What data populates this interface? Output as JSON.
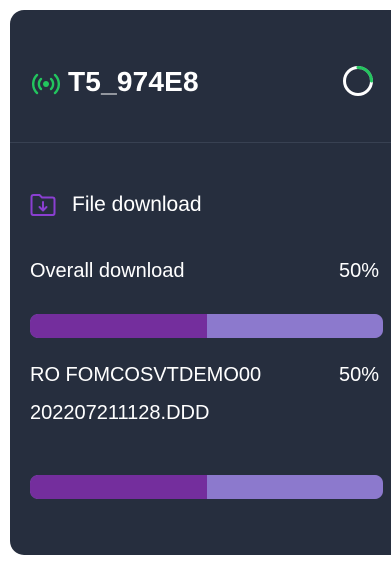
{
  "device": {
    "name": "T5_974E8",
    "signal_icon": "wifi-broadcast-icon",
    "status_icon": "loading-spinner-icon",
    "signal_color": "#22c55e"
  },
  "file_download": {
    "section_title": "File download",
    "section_icon": "folder-download-icon",
    "accent_color": "#8a3fd1",
    "overall": {
      "label": "Overall download",
      "percent_text": "50%",
      "progress": 0.5
    },
    "files": [
      {
        "name_line1": "RO FOMCOSVTDEMO00",
        "name_line2": "202207211128.DDD",
        "percent_text": "50%",
        "progress": 0.5
      }
    ]
  },
  "colors": {
    "card_bg": "#262e3e",
    "bar_track": "#8c79cd",
    "bar_fill": "#742e9d"
  }
}
